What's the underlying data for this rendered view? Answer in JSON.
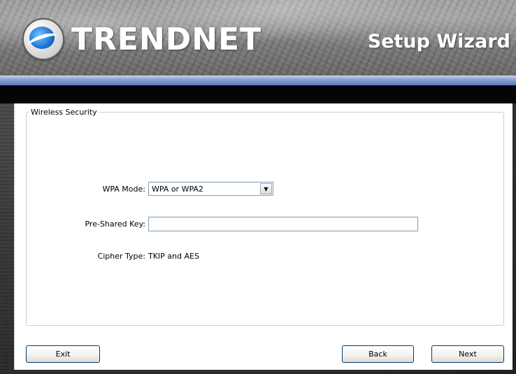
{
  "header": {
    "brand": "TRENDNET",
    "title": "Setup Wizard"
  },
  "security": {
    "group_title": "Wireless Security",
    "wpa_mode_label": "WPA Mode:",
    "wpa_mode_value": "WPA or WPA2",
    "psk_label": "Pre-Shared Key:",
    "psk_value": "",
    "cipher_label": "Cipher Type:",
    "cipher_value": "TKIP and AES"
  },
  "buttons": {
    "exit": "Exit",
    "back": "Back",
    "next": "Next"
  }
}
